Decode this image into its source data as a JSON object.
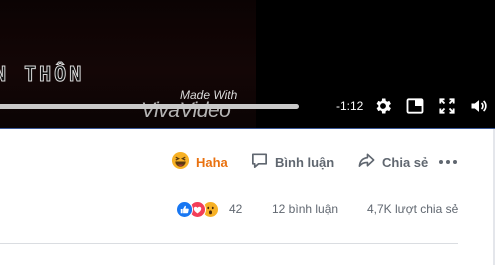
{
  "video": {
    "caption_text": "N THÔN",
    "watermark_small": "Made With",
    "watermark_big": "VivaVideo",
    "progress_fraction": 0.6,
    "time_remaining": "-1:12",
    "controls": [
      "settings-icon",
      "picture-in-picture-icon",
      "fullscreen-icon",
      "volume-icon"
    ]
  },
  "actions": {
    "haha_label": "Haha",
    "comment_label": "Bình luận",
    "share_label": "Chia sẻ",
    "more_icon": "more-dots-icon"
  },
  "stats": {
    "reaction_icons": [
      "like-icon",
      "love-icon",
      "wow-icon"
    ],
    "reaction_count": "42",
    "comment_count": "12 bình luận",
    "share_count": "4,7K lượt chia sẻ"
  },
  "colors": {
    "haha": "#e9710f",
    "text_gray": "#606770",
    "like_blue": "#1877f2",
    "love_red": "#f33e58",
    "wow_yellow": "#f7b125"
  }
}
